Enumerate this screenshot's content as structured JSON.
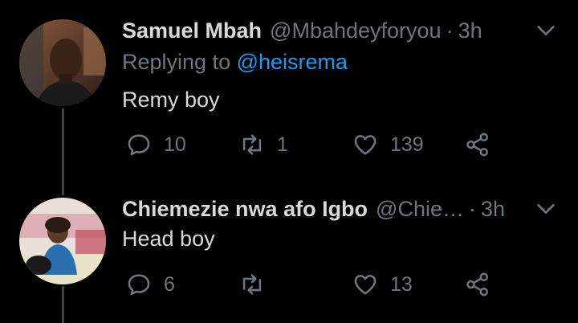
{
  "tweets": [
    {
      "name": "Samuel Mbah",
      "handle": "@Mbahdeyforyou",
      "separator": "·",
      "time": "3h",
      "replying_prefix": "Replying to",
      "replying_to": "@heisrema",
      "text": "Remy boy",
      "reply_count": "10",
      "retweet_count": "1",
      "like_count": "139"
    },
    {
      "name": "Chiemezie nwa afo Igbo",
      "handle": "@Chie…",
      "separator": "·",
      "time": "3h",
      "text": "Head boy",
      "reply_count": "6",
      "retweet_count": "",
      "like_count": "13"
    }
  ],
  "colors": {
    "background": "#000000",
    "primary_text": "#d9d9d9",
    "secondary_text": "#6e767d",
    "link": "#1d9bf0",
    "thread_line": "#3d4146"
  },
  "icons": [
    "reply-icon",
    "retweet-icon",
    "like-icon",
    "share-icon",
    "chevron-down-icon"
  ]
}
